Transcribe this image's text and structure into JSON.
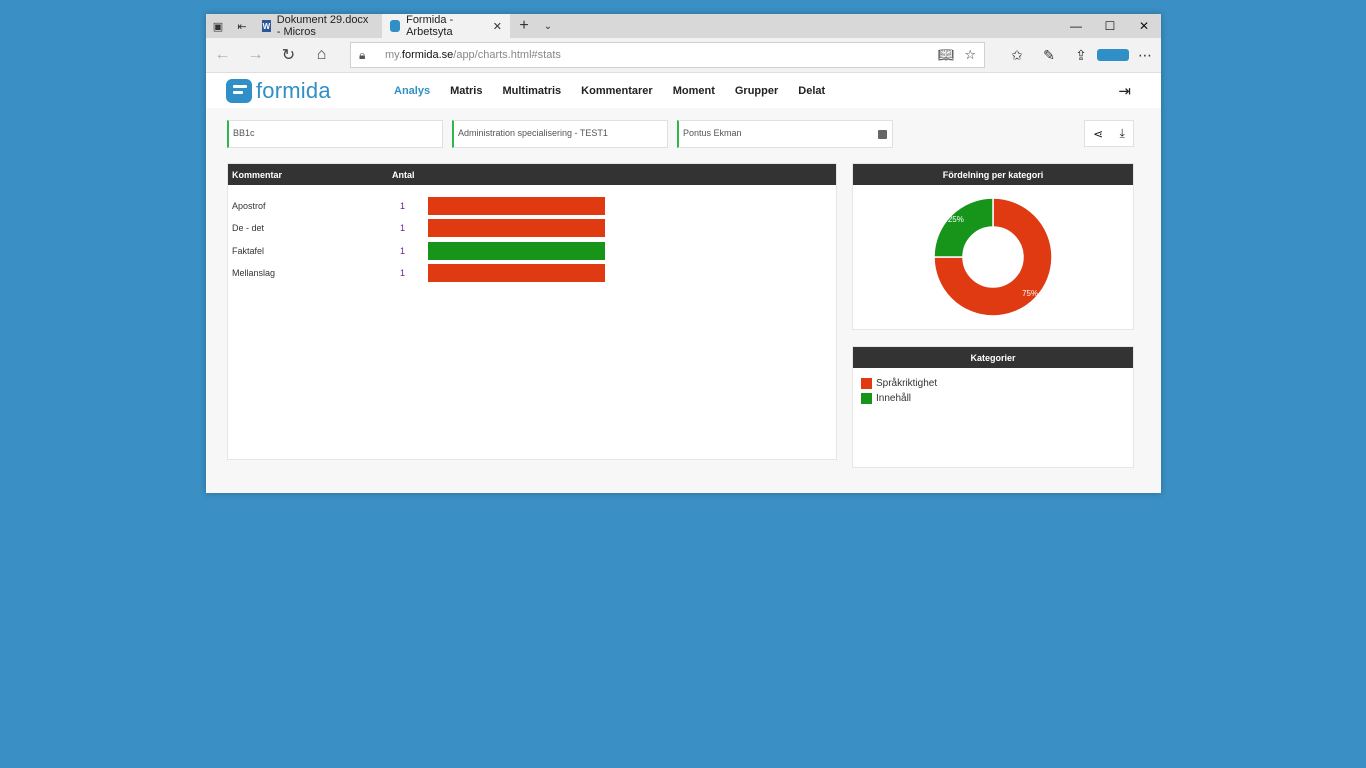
{
  "browser": {
    "tabs": [
      {
        "title": "Dokument 29.docx - Micros",
        "icon": "word-icon",
        "active": false
      },
      {
        "title": "Formida - Arbetsyta",
        "icon": "formida-icon",
        "active": true
      }
    ],
    "url_prefix": "my.",
    "url_domain": "formida.se",
    "url_path": "/app/charts.html#stats"
  },
  "app": {
    "logo_text": "formida",
    "menu": [
      "Analys",
      "Matris",
      "Multimatris",
      "Kommentarer",
      "Moment",
      "Grupper",
      "Delat"
    ],
    "active_menu": "Analys"
  },
  "selectors": [
    "BB1c",
    "Administration  specialisering - TEST1",
    "Pontus Ekman"
  ],
  "table": {
    "col1": "Kommentar",
    "col2": "Antal",
    "rows": [
      {
        "label": "Apostrof",
        "count": "1",
        "color": "#e03a12"
      },
      {
        "label": "De - det",
        "count": "1",
        "color": "#e03a12"
      },
      {
        "label": "Faktafel",
        "count": "1",
        "color": "#16951a"
      },
      {
        "label": "Mellanslag",
        "count": "1",
        "color": "#e03a12"
      }
    ]
  },
  "chart_data": {
    "type": "pie",
    "title": "Fördelning per kategori",
    "categories": [
      "Språkriktighet",
      "Innehåll"
    ],
    "values": [
      75,
      25
    ],
    "labels": [
      "75%",
      "25%"
    ],
    "colors": [
      "#e03a12",
      "#16951a"
    ]
  },
  "legend": {
    "title": "Kategorier",
    "items": [
      {
        "label": "Språkriktighet",
        "color": "#e03a12"
      },
      {
        "label": "Innehåll",
        "color": "#16951a"
      }
    ]
  }
}
